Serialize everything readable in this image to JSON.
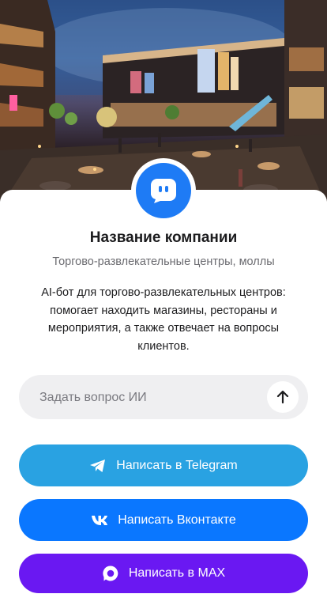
{
  "company": {
    "name": "Название компании",
    "category": "Торгово-развлекательные центры, моллы",
    "description": "AI-бот для торгово-развлекательных центров: помогает находить магазины, рестораны и мероприятия, а также отвечает на вопросы клиентов."
  },
  "ask": {
    "placeholder": "Задать вопрос ИИ",
    "value": "",
    "send_icon": "arrow-up-icon"
  },
  "buttons": {
    "telegram": {
      "label": "Написать в Telegram",
      "icon": "telegram-icon",
      "color": "#29a2e2"
    },
    "vk": {
      "label": "Написать Вконтакте",
      "icon": "vk-icon",
      "color": "#0a77ff"
    },
    "max": {
      "label": "Написать в MAX",
      "icon": "max-icon",
      "color": "#6a18f2"
    }
  },
  "colors": {
    "avatar_bg": "#1e7bf5"
  }
}
